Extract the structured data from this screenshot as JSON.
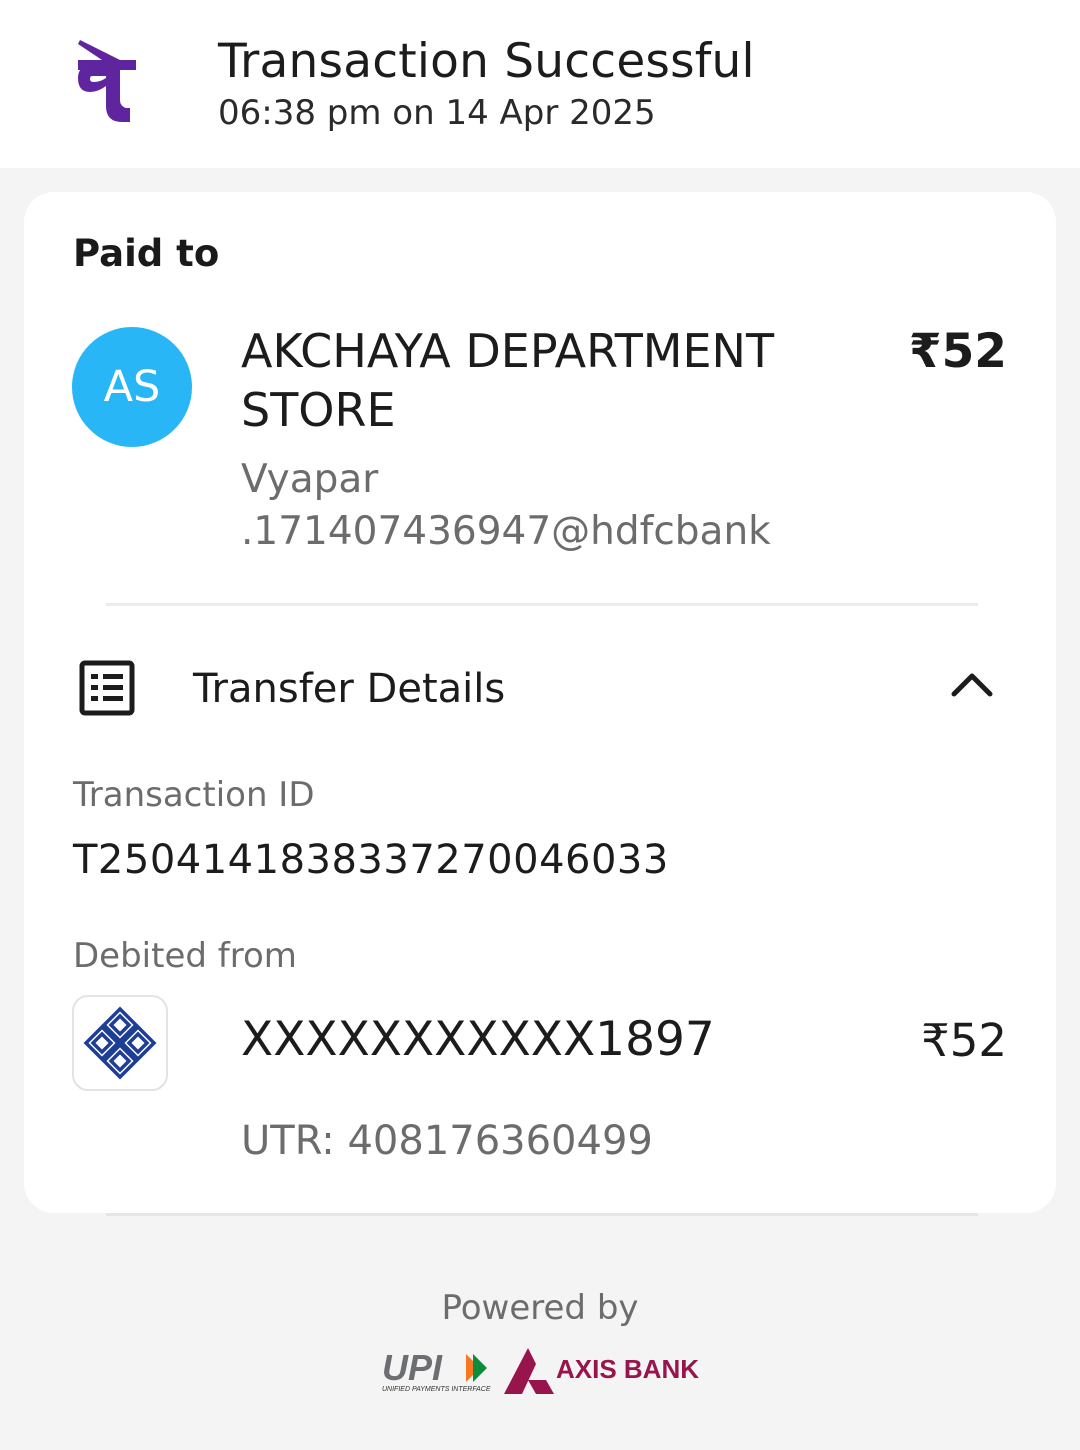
{
  "header": {
    "brand_icon": "phonepe-logo-icon",
    "title": "Transaction Successful",
    "timestamp": "06:38 pm on 14 Apr 2025"
  },
  "paid_to": {
    "heading": "Paid to",
    "avatar_initials": "AS",
    "avatar_color": "#29b6f6",
    "name": "AKCHAYA DEPARTMENT STORE",
    "upi_id": "Vyapar .171407436947@hdfcbank",
    "amount": "₹52"
  },
  "transfer_details": {
    "label": "Transfer Details",
    "icon": "receipt-list-icon",
    "toggle_icon": "chevron-up-icon",
    "transaction_id_label": "Transaction ID",
    "transaction_id": "T2504141838337270046033",
    "debited_from_label": "Debited from",
    "bank_icon": "bank-of-india-logo-icon",
    "account_number": "XXXXXXXXXXX1897",
    "account_amount": "₹52",
    "utr": "UTR: 408176360499"
  },
  "footer": {
    "powered_by": "Powered by",
    "upi_logo_text": "UPI",
    "upi_tagline": "UNIFIED PAYMENTS INTERFACE",
    "bank_logo_text": "AXIS BANK"
  },
  "colors": {
    "brand_purple": "#5f259f",
    "axis_maroon": "#97144d",
    "bank_blue": "#1e3e96"
  }
}
